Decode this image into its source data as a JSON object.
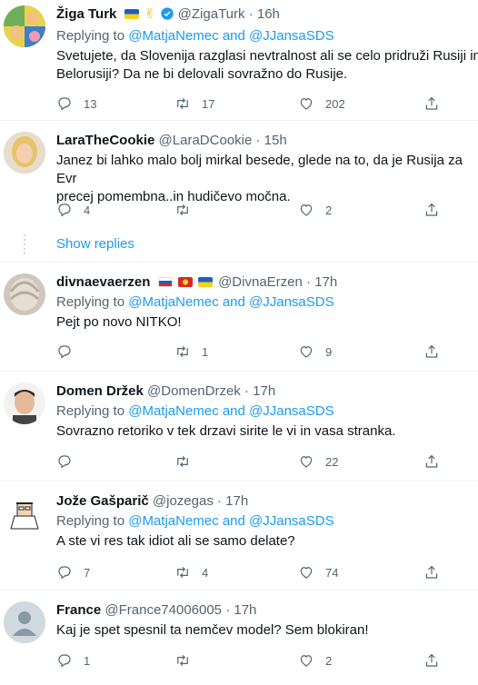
{
  "tweets": [
    {
      "name": "Žiga Turk",
      "handle": "@ZigaTurk",
      "time": "16h",
      "reply_label": "Replying to",
      "reply_to_1": "@MatjaNemec",
      "reply_and": "and",
      "reply_to_2": "@JJansaSDS",
      "text": "Svetujete, da Slovenija razglasi nevtralnost ali se celo pridruži Rusiji in\nBelorusiji? Da ne bi delovali sovražno do Rusije.",
      "replies": "13",
      "retweets": "17",
      "likes": "202"
    },
    {
      "name": "LaraTheCookie",
      "handle": "@LaraDCookie",
      "time": "15h",
      "text": "Janez bi lahko malo bolj mirkal besede, glede na to, da je Rusija za Evr\nprecej pomembna..in hudičevo močna.",
      "replies": "4",
      "retweets": "",
      "likes": "2"
    },
    {
      "name": "divnaevaerzen",
      "handle": "@DivnaErzen",
      "time": "17h",
      "reply_label": "Replying to",
      "reply_to_1": "@MatjaNemec",
      "reply_and": "and",
      "reply_to_2": "@JJansaSDS",
      "text": "Pejt po novo NITKO!",
      "replies": "",
      "retweets": "1",
      "likes": "9"
    },
    {
      "name": "Domen Držek",
      "handle": "@DomenDrzek",
      "time": "17h",
      "reply_label": "Replying to",
      "reply_to_1": "@MatjaNemec",
      "reply_and": "and",
      "reply_to_2": "@JJansaSDS",
      "text": "Sovrazno retoriko v tek drzavi sirite le vi in vasa stranka.",
      "replies": "",
      "retweets": "",
      "likes": "22"
    },
    {
      "name": "Jože Gašparič",
      "handle": "@jozegas",
      "time": "17h",
      "reply_label": "Replying to",
      "reply_to_1": "@MatjaNemec",
      "reply_and": "and",
      "reply_to_2": "@JJansaSDS",
      "text": "A ste vi res tak idiot ali se samo delate?",
      "replies": "7",
      "retweets": "4",
      "likes": "74"
    },
    {
      "name": "France",
      "handle": "@France74006005",
      "time": "17h",
      "text": "Kaj je spet spesnil ta nemčev model? Sem blokiran!",
      "replies": "1",
      "retweets": "",
      "likes": "2"
    }
  ],
  "show_replies": "Show replies",
  "separator": "·",
  "colors": {
    "accent": "#1d9bf0",
    "muted": "#536471",
    "text": "#0f1419",
    "border": "#eff3f4"
  },
  "icons": [
    "reply-icon",
    "retweet-icon",
    "like-icon",
    "share-icon",
    "verified-icon",
    "flag-ukraine",
    "flag-slovenia",
    "flag-macedonia",
    "victory-hand-emoji"
  ]
}
